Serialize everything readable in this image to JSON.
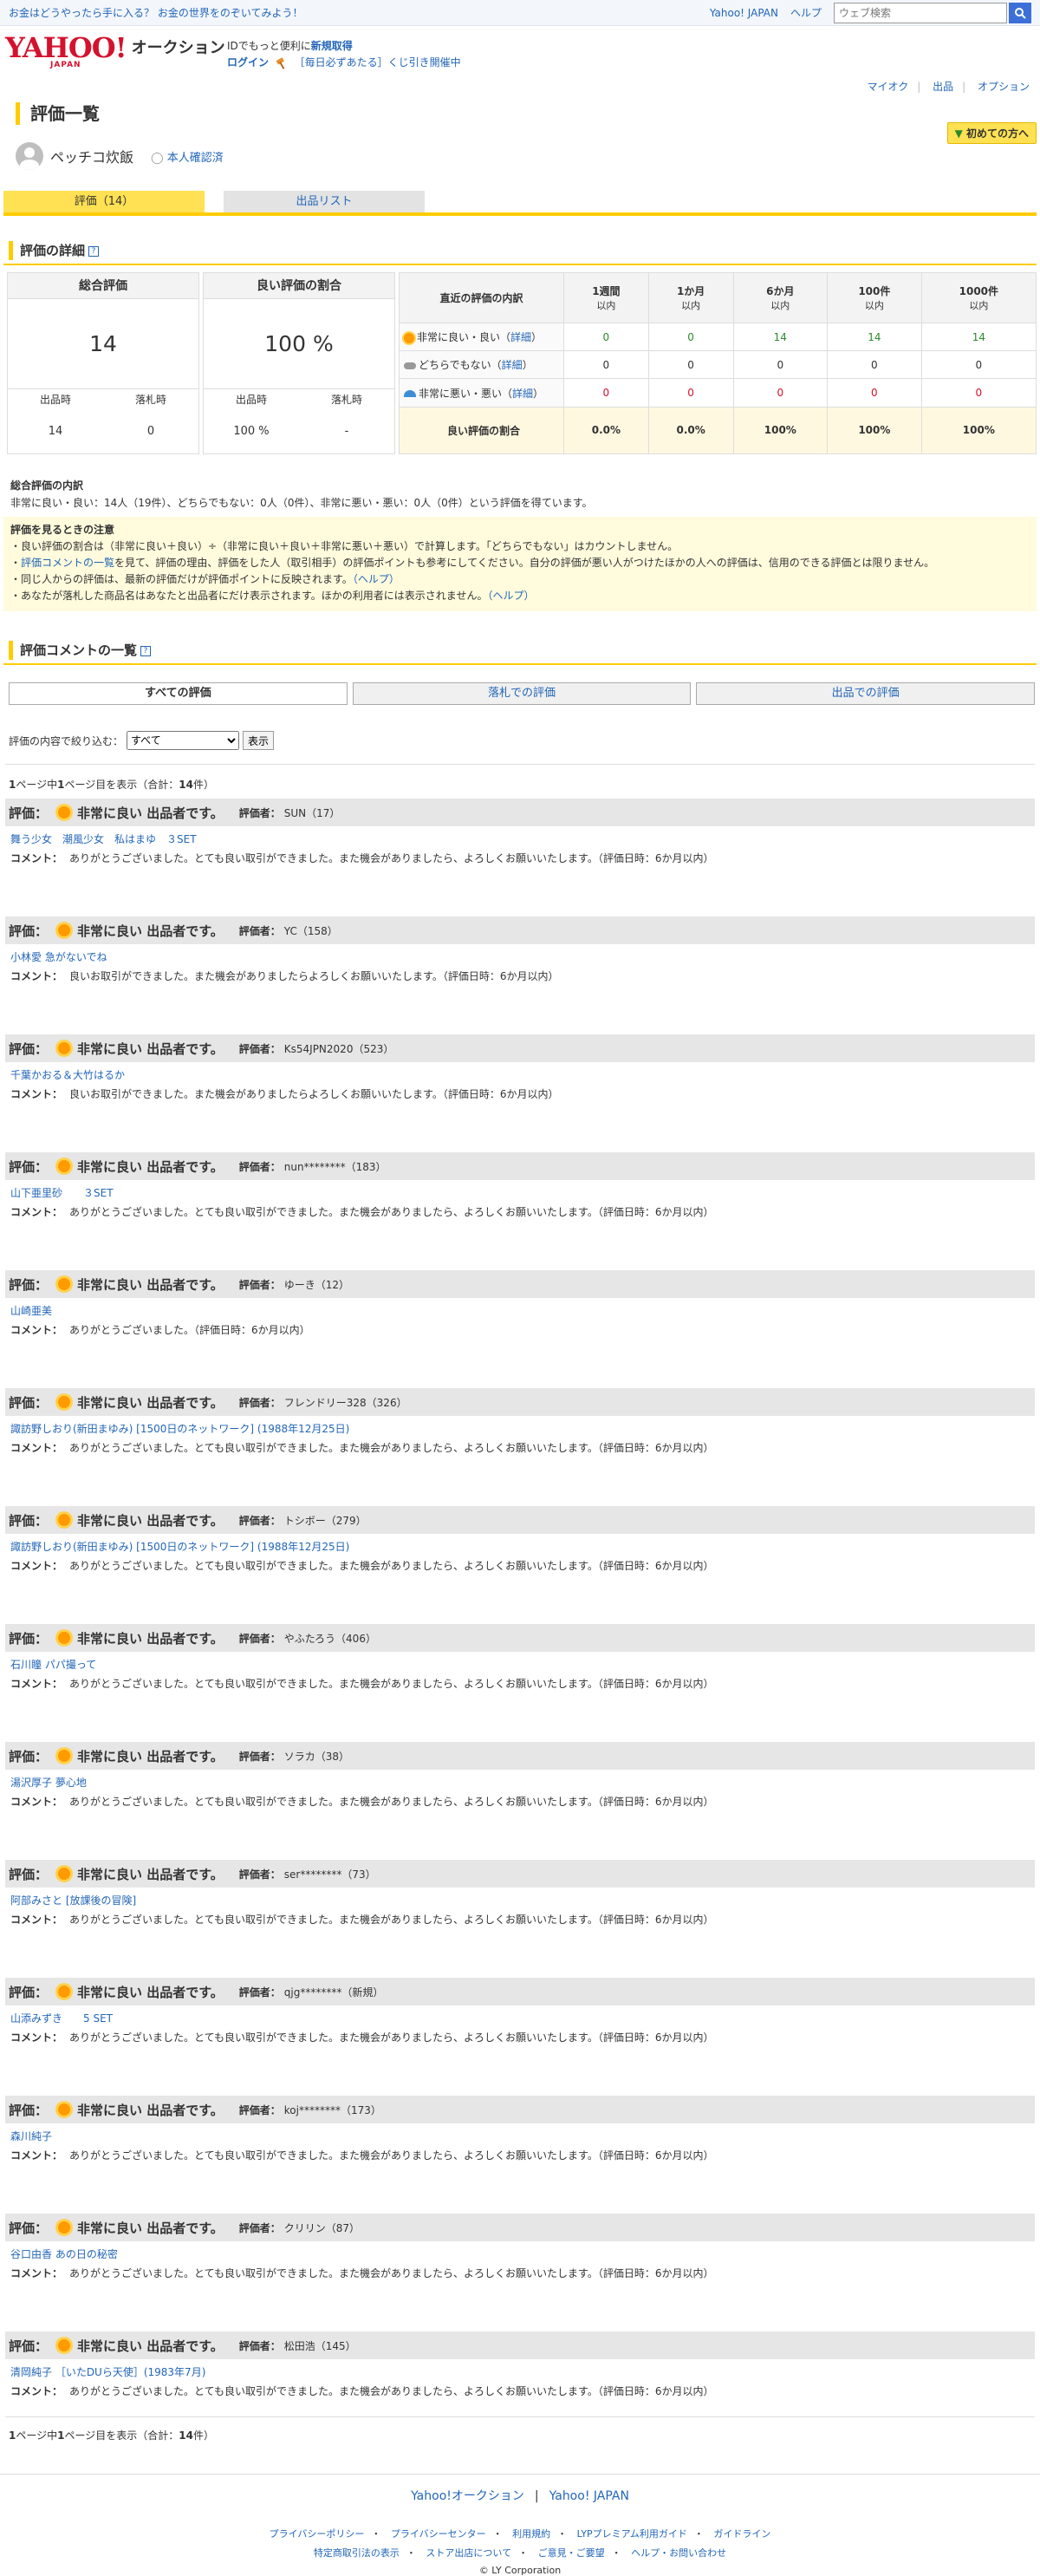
{
  "topbar": {
    "promo": "お金はどうやったら手に入る？ お金の世界をのぞいてみよう！",
    "yahoo_japan": "Yahoo! JAPAN",
    "help": "ヘルプ",
    "search_placeholder": "ウェブ検索"
  },
  "header": {
    "logo_text": "YAHOO!",
    "logo_sub": "JAPAN",
    "logo_auction": "オークション",
    "id_promo_prefix": "IDでもっと便利に",
    "id_promo_link": "新規取得",
    "login": "ログイン",
    "lottery": "［毎日必ずあたる］くじ引き開催中"
  },
  "utilnav": {
    "myauc": "マイオク",
    "sell": "出品",
    "options": "オプション"
  },
  "page": {
    "title": "評価一覧",
    "first_time": "初めての方へ"
  },
  "user": {
    "name": "ペッチコ炊飯",
    "verified": "本人確認済"
  },
  "tabs": {
    "ratings": "評価（14）",
    "listings": "出品リスト"
  },
  "detail": {
    "section_title": "評価の詳細",
    "total": {
      "header": "総合評価",
      "value": "14",
      "seller_label": "出品時",
      "buyer_label": "落札時",
      "seller_value": "14",
      "buyer_value": "0"
    },
    "good_ratio": {
      "header": "良い評価の割合",
      "value": "100 %",
      "seller_label": "出品時",
      "buyer_label": "落札時",
      "seller_value": "100 %",
      "buyer_value": "-"
    },
    "recent": {
      "header": "直近の評価の内訳",
      "columns": [
        {
          "top": "1週間",
          "bottom": "以内"
        },
        {
          "top": "1か月",
          "bottom": "以内"
        },
        {
          "top": "6か月",
          "bottom": "以内"
        },
        {
          "top": "100件",
          "bottom": "以内"
        },
        {
          "top": "1000件",
          "bottom": "以内"
        }
      ],
      "detail_link": "詳細",
      "rows": [
        {
          "label": "非常に良い・良い",
          "values": [
            "0",
            "0",
            "14",
            "14",
            "14"
          ]
        },
        {
          "label": "どちらでもない",
          "values": [
            "0",
            "0",
            "0",
            "0",
            "0"
          ]
        },
        {
          "label": "非常に悪い・悪い",
          "values": [
            "0",
            "0",
            "0",
            "0",
            "0"
          ]
        }
      ],
      "ratio_label": "良い評価の割合",
      "ratio_values": [
        "0.0%",
        "0.0%",
        "100%",
        "100%",
        "100%"
      ]
    }
  },
  "breakdown": {
    "title": "総合評価の内訳",
    "text": "非常に良い・良い：14人（19件）、どちらでもない：0人（0件）、非常に悪い・悪い：0人（0件）という評価を得ています。"
  },
  "notes": {
    "title": "評価を見るときの注意",
    "line1": "・良い評価の割合は（非常に良い＋良い）÷（非常に良い＋良い＋非常に悪い＋悪い）で計算します。「どちらでもない」はカウントしません。",
    "line2_prefix": "・",
    "line2_link": "評価コメントの一覧",
    "line2_text": "を見て、評価の理由、評価をした人（取引相手）の評価ポイントも参考にしてください。自分の評価が悪い人がつけたほかの人への評価は、信用のできる評価とは限りません。",
    "line3_text": "・同じ人からの評価は、最新の評価だけが評価ポイントに反映されます。",
    "line3_link": "（ヘルプ）",
    "line4_text": "・あなたが落札した商品名はあなたと出品者にだけ表示されます。ほかの利用者には表示されません。",
    "line4_link": "（ヘルプ）"
  },
  "comments": {
    "section_title": "評価コメントの一覧",
    "filter_tabs": [
      "すべての評価",
      "落札での評価",
      "出品での評価"
    ],
    "filter_label": "評価の内容で絞り込む：",
    "filter_value": "すべて",
    "filter_button": "表示",
    "pager": {
      "p1": "1",
      "mid1": "ページ中",
      "p2": "1",
      "mid2": "ページ目を表示（合計：",
      "total": "14",
      "end": "件）"
    },
    "rating_label": "評価：",
    "rating_text": "非常に良い 出品者です。",
    "rater_label": "評価者：",
    "comment_label": "コメント："
  },
  "reviews": [
    {
      "rater": "SUN（17）",
      "item": "舞う少女　潮風少女　私はまゆ　３SET",
      "comment": "ありがとうございました。とても良い取引ができました。また機会がありましたら、よろしくお願いいたします。（評価日時：6か月以内）"
    },
    {
      "rater": "YC（158）",
      "item": "小林愛 急がないでね",
      "comment": "良いお取引ができました。また機会がありましたらよろしくお願いいたします。（評価日時：6か月以内）"
    },
    {
      "rater": "Ks54JPN2020（523）",
      "item": "千葉かおる＆大竹はるか",
      "comment": "良いお取引ができました。また機会がありましたらよろしくお願いいたします。（評価日時：6か月以内）"
    },
    {
      "rater": "nun********（183）",
      "item": "山下亜里砂　　３SET",
      "comment": "ありがとうございました。とても良い取引ができました。また機会がありましたら、よろしくお願いいたします。（評価日時：6か月以内）"
    },
    {
      "rater": "ゆーき（12）",
      "item": "山崎亜美",
      "comment": "ありがとうございました。（評価日時：6か月以内）"
    },
    {
      "rater": "フレンドリー328（326）",
      "item": "諏訪野しおり(新田まゆみ) [1500日のネットワーク] (1988年12月25日)",
      "comment": "ありがとうございました。とても良い取引ができました。また機会がありましたら、よろしくお願いいたします。（評価日時：6か月以内）"
    },
    {
      "rater": "トシボー（279）",
      "item": "諏訪野しおり(新田まゆみ) [1500日のネットワーク] (1988年12月25日)",
      "comment": "ありがとうございました。とても良い取引ができました。また機会がありましたら、よろしくお願いいたします。（評価日時：6か月以内）"
    },
    {
      "rater": "やふたろう（406）",
      "item": "石川瞳 パパ撮って",
      "comment": "ありがとうございました。とても良い取引ができました。また機会がありましたら、よろしくお願いいたします。（評価日時：6か月以内）"
    },
    {
      "rater": "ソラカ（38）",
      "item": "湯沢厚子 夢心地",
      "comment": "ありがとうございました。とても良い取引ができました。また機会がありましたら、よろしくお願いいたします。（評価日時：6か月以内）"
    },
    {
      "rater": "ser********（73）",
      "item": "阿部みさと [放課後の冒険]",
      "comment": "ありがとうございました。とても良い取引ができました。また機会がありましたら、よろしくお願いいたします。（評価日時：6か月以内）"
    },
    {
      "rater": "qjg********（新規）",
      "item": "山添みずき　　5 SET",
      "comment": "ありがとうございました。とても良い取引ができました。また機会がありましたら、よろしくお願いいたします。（評価日時：6か月以内）"
    },
    {
      "rater": "koj********（173）",
      "item": "森川純子",
      "comment": "ありがとうございました。とても良い取引ができました。また機会がありましたら、よろしくお願いいたします。（評価日時：6か月以内）"
    },
    {
      "rater": "クリリン（87）",
      "item": "谷口由香 あの日の秘密",
      "comment": "ありがとうございました。とても良い取引ができました。また機会がありましたら、よろしくお願いいたします。（評価日時：6か月以内）"
    },
    {
      "rater": "松田浩（145）",
      "item": "清岡純子 ［いたDUら天使］(1983年7月)",
      "comment": "ありがとうございました。とても良い取引ができました。また機会がありましたら、よろしくお願いいたします。（評価日時：6か月以内）"
    }
  ],
  "footer": {
    "auction": "Yahoo!オークション",
    "yahoo_japan": "Yahoo! JAPAN",
    "links1": [
      "プライバシーポリシー",
      "プライバシーセンター",
      "利用規約",
      "LYPプレミアム利用ガイド",
      "ガイドライン"
    ],
    "links2": [
      "特定商取引法の表示",
      "ストア出店について",
      "ご意見・ご要望",
      "ヘルプ・お問い合わせ"
    ],
    "copyright": "© LY Corporation"
  }
}
